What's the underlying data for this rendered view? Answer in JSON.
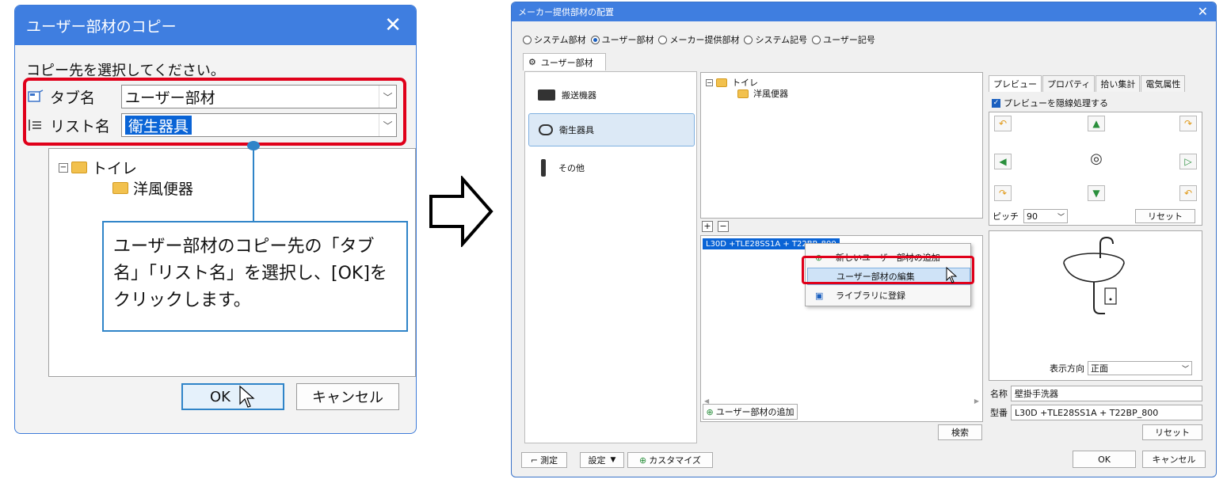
{
  "left_dialog": {
    "title": "ユーザー部材のコピー",
    "prompt": "コピー先を選択してください。",
    "tab_label": "タブ名",
    "tab_value": "ユーザー部材",
    "list_label": "リスト名",
    "list_value": "衛生器具",
    "tree_root": "トイレ",
    "tree_child": "洋風便器",
    "callout_text": "ユーザー部材のコピー先の「タブ名」「リスト名」を選択し、[OK]をクリックします。",
    "ok_label": "OK",
    "cancel_label": "キャンセル"
  },
  "right_window": {
    "title": "メーカー提供部材の配置",
    "radios": [
      {
        "label": "システム部材",
        "checked": false
      },
      {
        "label": "ユーザー部材",
        "checked": true
      },
      {
        "label": "メーカー提供部材",
        "checked": false
      },
      {
        "label": "システム記号",
        "checked": false
      },
      {
        "label": "ユーザー記号",
        "checked": false
      }
    ],
    "tab_label": "ユーザー部材",
    "categories": [
      "搬送機器",
      "衛生器具",
      "その他"
    ],
    "tree_root": "トイレ",
    "tree_child": "洋風便器",
    "list_item": "L30D +TLE28SS1A + T22BP_800",
    "context_menu": [
      "新しいユーザー部材の追加",
      "ユーザー部材の編集",
      "ライブラリに登録"
    ],
    "add_button": "ユーザー部材の追加",
    "search_button": "検索",
    "preview_tabs": [
      "プレビュー",
      "プロパティ",
      "拾い集計",
      "電気属性"
    ],
    "hidden_line_checkbox": "プレビューを隠線処理する",
    "pitch_label": "ピッチ",
    "pitch_value": "90",
    "reset_label": "リセット",
    "direction_label": "表示方向",
    "direction_value": "正面",
    "name_label": "名称",
    "name_value": "壁掛手洗器",
    "model_label": "型番",
    "model_value": "L30D +TLE28SS1A + T22BP_800",
    "reset2_label": "リセット",
    "measure_button": "測定",
    "settings_button": "設定",
    "customize_button": "カスタマイズ",
    "ok_label": "OK",
    "cancel_label": "キャンセル"
  },
  "colors": {
    "title_blue": "#3f7ee0",
    "highlight_red": "#e0001a",
    "callout_blue": "#2f84c8",
    "selection_blue": "#0a64d6"
  }
}
